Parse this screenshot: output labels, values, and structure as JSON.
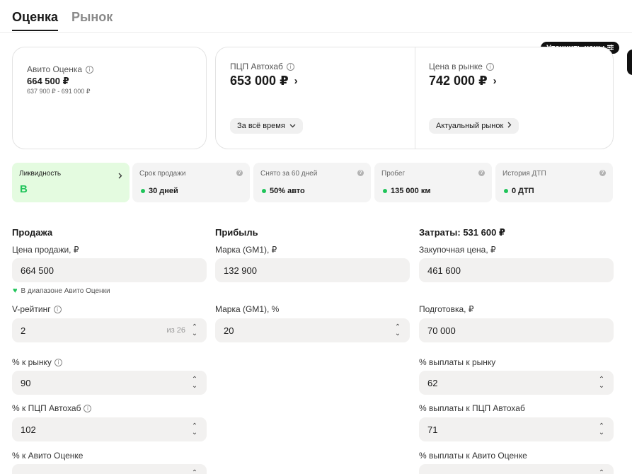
{
  "tabs": [
    {
      "label": "Оценка",
      "active": true
    },
    {
      "label": "Рынок",
      "active": false
    }
  ],
  "refine_button": {
    "label": "Уточнить цены"
  },
  "avito_card": {
    "label": "Авито Оценка",
    "value": "664 500 ₽",
    "range": "637 900 ₽ - 691 000 ₽"
  },
  "pcp_card": {
    "label": "ПЦП Автохаб",
    "value": "653 000 ₽",
    "period_button": "За всё время"
  },
  "market_card": {
    "label": "Цена в рынке",
    "value": "742 000 ₽",
    "market_button": "Актуальный рынок"
  },
  "metrics": [
    {
      "title": "Ликвидность",
      "value": "B",
      "highlighted": true
    },
    {
      "title": "Срок продажи",
      "value": "30 дней"
    },
    {
      "title": "Снято за 60 дней",
      "value": "50% авто"
    },
    {
      "title": "Пробег",
      "value": "135 000 км"
    },
    {
      "title": "История ДТП",
      "value": "0 ДТП"
    }
  ],
  "sale": {
    "title": "Продажа",
    "price_label": "Цена продажи, ₽",
    "price_value": "664 500",
    "range_hint": "В диапазоне Авито Оценки",
    "vrating_label": "V-рейтинг",
    "vrating_value": "2",
    "vrating_suffix": "из 26",
    "to_market_label": "% к рынку",
    "to_market_value": "90",
    "to_pcp_label": "% к ПЦП Автохаб",
    "to_pcp_value": "102",
    "to_avito_label": "% к Авито Оценке"
  },
  "profit": {
    "title": "Прибыль",
    "margin_rub_label": "Марка (GM1), ₽",
    "margin_rub_value": "132 900",
    "margin_pct_label": "Марка (GM1), %",
    "margin_pct_value": "20"
  },
  "costs": {
    "title": "Затраты: 531 600 ₽",
    "purchase_label": "Закупочная цена, ₽",
    "purchase_value": "461 600",
    "prep_label": "Подготовка, ₽",
    "prep_value": "70 000",
    "payout_market_label": "% выплаты к рынку",
    "payout_market_value": "62",
    "payout_pcp_label": "% выплаты к ПЦП Автохаб",
    "payout_pcp_value": "71",
    "payout_avito_label": "% выплаты к Авито Оценке"
  },
  "colors": {
    "accent_green": "#20c45a",
    "liquidity_bg": "#e4fbe0",
    "field_bg": "#f2f1f0"
  },
  "icons": [
    "info-icon",
    "chevron-right-icon",
    "chevron-down-icon",
    "question-icon",
    "filter-icon",
    "stepper-icon",
    "heart-icon",
    "status-dot"
  ]
}
